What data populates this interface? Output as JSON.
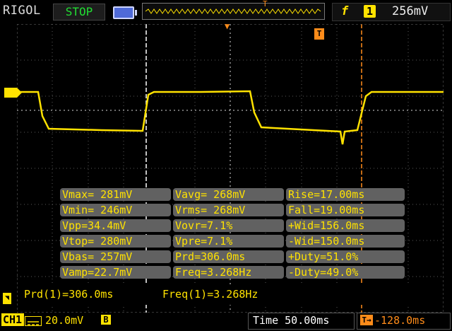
{
  "header": {
    "brand": "RIGOL",
    "run_status": "STOP",
    "trigger": {
      "edge_icon": "rising-edge-icon",
      "source": "1",
      "level": "256mV"
    }
  },
  "measurements": [
    [
      "Vmax= 281mV",
      "Vavg= 268mV",
      "Rise=17.00ms"
    ],
    [
      "Vmin= 246mV",
      "Vrms= 268mV",
      "Fall=19.00ms"
    ],
    [
      "Vpp=34.4mV",
      "Vovr=7.1%",
      "+Wid=156.0ms"
    ],
    [
      "Vtop= 280mV",
      "Vpre=7.1%",
      "-Wid=150.0ms"
    ],
    [
      "Vbas= 257mV",
      "Prd=306.0ms",
      "+Duty=51.0%"
    ],
    [
      "Vamp=22.7mV",
      "Freq=3.268Hz",
      "-Duty=49.0%"
    ]
  ],
  "quick_meas": {
    "period": "Prd(1)=306.0ms",
    "frequency": "Freq(1)=3.268Hz"
  },
  "footer": {
    "channel": "CH1",
    "volts_per_div": "20.0mV",
    "bandwidth_limit": "B",
    "timebase": "Time 50.00ms",
    "trigger_offset": "-128.0ms"
  },
  "colors": {
    "trace": "#ffe200",
    "accent": "#ff8c1a",
    "status": "#22dd33",
    "grid": "#5a5a5a"
  }
}
